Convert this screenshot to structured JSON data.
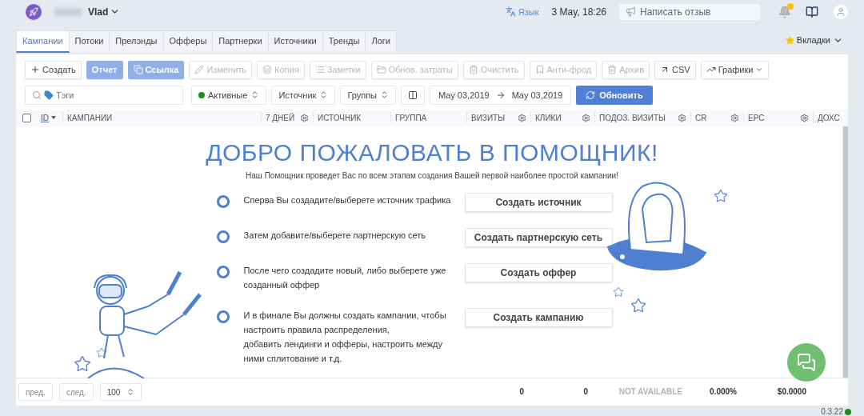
{
  "header": {
    "user_name": "Vlad",
    "language": "Язык",
    "datetime": "3 May, 18:26",
    "feedback": "Написать отзыв",
    "notifications": true
  },
  "tabs": [
    {
      "label": "Кампании",
      "selected": true
    },
    {
      "label": "Потоки",
      "selected": false
    },
    {
      "label": "Прелэнды",
      "selected": false
    },
    {
      "label": "Офферы",
      "selected": false
    },
    {
      "label": "Партнерки",
      "selected": false
    },
    {
      "label": "Источники",
      "selected": false
    },
    {
      "label": "Тренды",
      "selected": false
    },
    {
      "label": "Логи",
      "selected": false
    }
  ],
  "tabs_menu": "Вкладки",
  "toolbar": [
    {
      "label": "Создать",
      "kind": "outline",
      "disabled": false
    },
    {
      "label": "Отчет",
      "kind": "primary",
      "disabled": false
    },
    {
      "label": "Ссылка",
      "kind": "primary",
      "disabled": false
    },
    {
      "label": "Изменить",
      "kind": "outline",
      "disabled": true
    },
    {
      "label": "Копия",
      "kind": "outline",
      "disabled": true
    },
    {
      "label": "Заметки",
      "kind": "outline",
      "disabled": true
    },
    {
      "label": "Обнов. затраты",
      "kind": "outline",
      "disabled": true
    },
    {
      "label": "Очистить",
      "kind": "outline",
      "disabled": true
    },
    {
      "label": "Анти-фрод",
      "kind": "outline",
      "disabled": true
    },
    {
      "label": "Архив",
      "kind": "outline",
      "disabled": true
    },
    {
      "label": "CSV",
      "kind": "outline",
      "disabled": false
    },
    {
      "label": "Графики",
      "kind": "outline",
      "disabled": false
    }
  ],
  "filters": {
    "search_placeholder": "Тэги",
    "selects": [
      {
        "label": "Активные",
        "color": "#1a8f1a"
      },
      {
        "label": "Источник"
      },
      {
        "label": "Группы"
      }
    ],
    "date_from": "May 03,2019",
    "date_to": "May 03,2019",
    "refresh": "Обновить"
  },
  "table": {
    "select_all": {
      "checked": false
    },
    "columns": [
      {
        "label": "ID",
        "sorted": true
      },
      {
        "label": "КАМПАНИИ",
        "sorted": false
      },
      {
        "label": "7 ДНЕЙ",
        "sorted": false,
        "settings": true
      },
      {
        "label": "ИСТОЧНИК",
        "sorted": false
      },
      {
        "label": "ГРУППА",
        "sorted": false
      },
      {
        "label": "ВИЗИТЫ",
        "sorted": false,
        "settings": true
      },
      {
        "label": "КЛИКИ",
        "sorted": false,
        "settings": true
      },
      {
        "label": "ПОДОЗ. ВИЗИТЫ",
        "sorted": false,
        "settings": true
      },
      {
        "label": "CR",
        "sorted": false,
        "settings": true
      },
      {
        "label": "EPC",
        "sorted": false,
        "settings": true
      },
      {
        "label": "ДОХС",
        "sorted": false
      }
    ]
  },
  "welcome": {
    "title": "ДОБРО ПОЖАЛОВАТЬ В ПОМОЩНИК!",
    "subtitle": "Наш Помощник проведет Вас по всем этапам создания Вашей первой наиболее простой кампании!",
    "steps": [
      {
        "text": "Сперва Вы создадите/выберете источник трафика",
        "done": false,
        "action": "Создать источник"
      },
      {
        "text": "Затем добавите/выберете партнерскую сеть",
        "done": false,
        "action": "Создать партнерскую сеть"
      },
      {
        "text": "После чего создадите новый, либо выберете уже созданный оффер",
        "done": false,
        "action": "Создать оффер"
      },
      {
        "text": "И в финале Вы должны создать кампании, чтобы настроить правила распределения,\nдобавить лендинги и офферы, настроить между ними сплитование и т.д.",
        "done": false,
        "action": "Создать кампанию"
      }
    ]
  },
  "footer": {
    "prev": "пред.",
    "next": "след.",
    "page_size": "100",
    "totals": [
      {
        "value": "0",
        "muted": false
      },
      {
        "value": "0",
        "muted": false
      },
      {
        "value": "NOT AVAILABLE",
        "muted": true
      },
      {
        "value": "0.000%",
        "muted": false
      },
      {
        "value": "$0.0000",
        "muted": false
      }
    ]
  },
  "version": {
    "label": "0.3.22",
    "online": true
  }
}
